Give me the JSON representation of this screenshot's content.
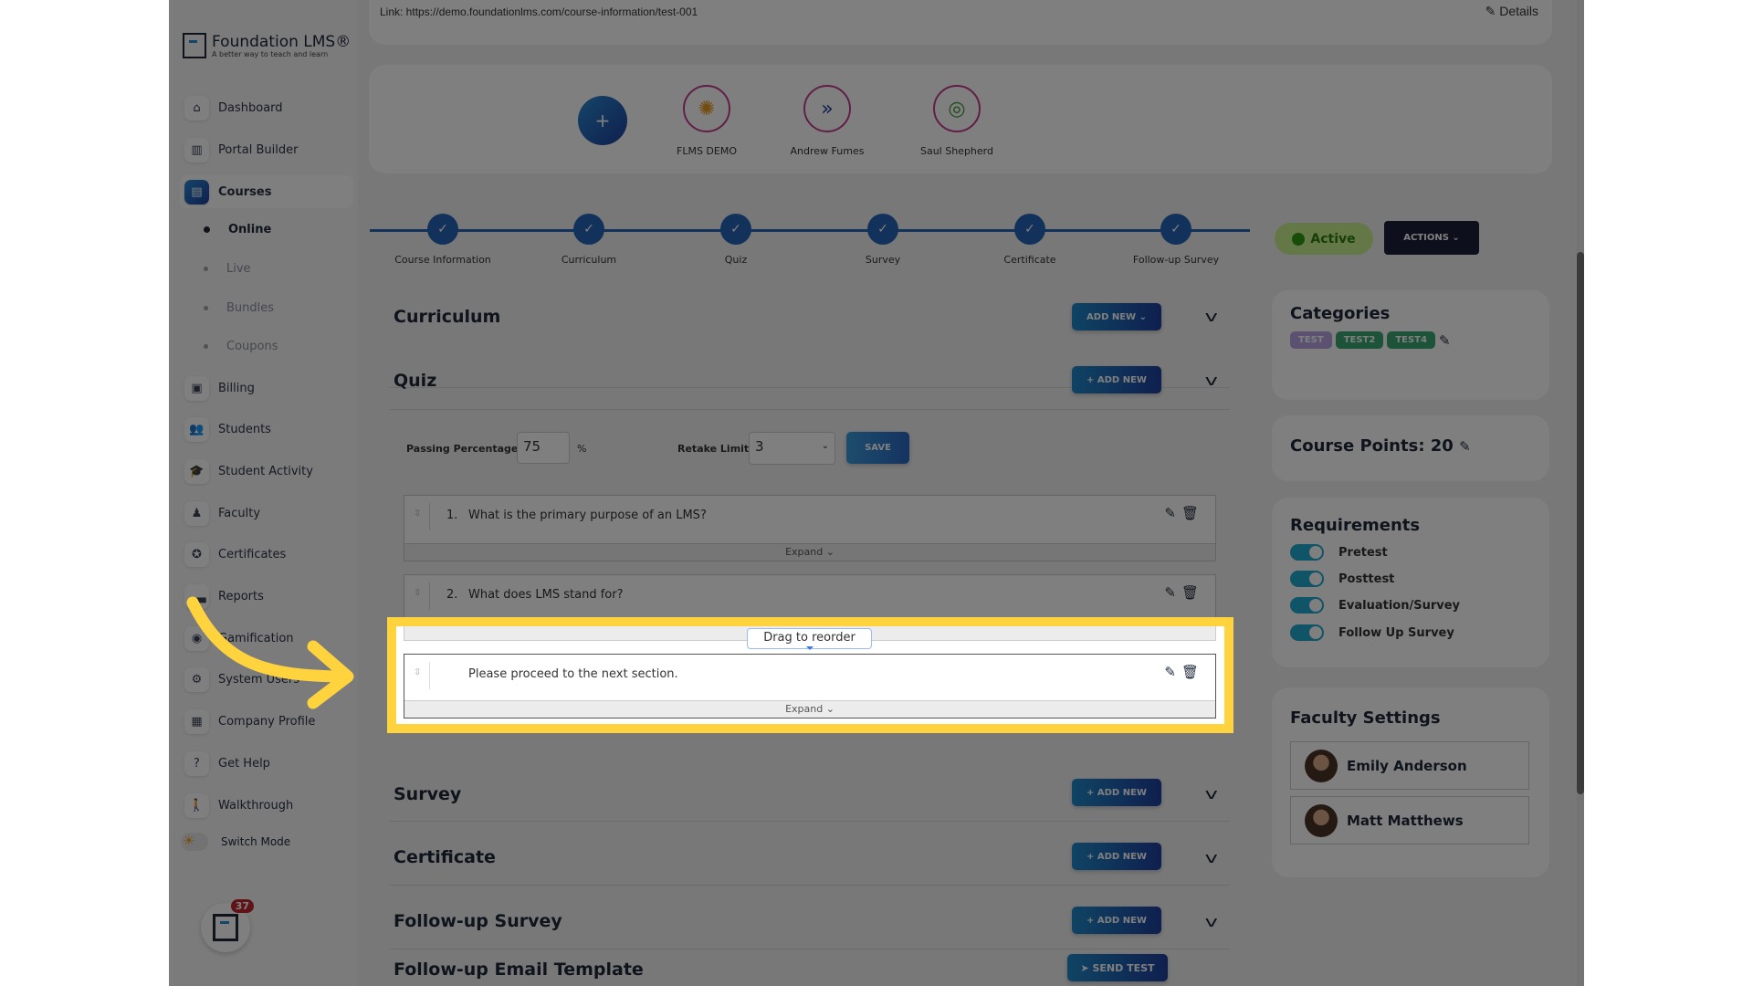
{
  "brand": {
    "name": "Foundation LMS®",
    "tagline": "A better way to teach and learn"
  },
  "sidebar": {
    "items": [
      {
        "label": "Dashboard",
        "icon": "home-icon"
      },
      {
        "label": "Portal Builder",
        "icon": "portal-icon"
      },
      {
        "label": "Courses",
        "icon": "book-icon",
        "active": true
      },
      {
        "label": "Billing",
        "icon": "receipt-icon"
      },
      {
        "label": "Students",
        "icon": "users-icon"
      },
      {
        "label": "Student Activity",
        "icon": "graduation-cap-icon"
      },
      {
        "label": "Faculty",
        "icon": "teacher-icon"
      },
      {
        "label": "Certificates",
        "icon": "award-icon"
      },
      {
        "label": "Reports",
        "icon": "chart-icon"
      },
      {
        "label": "Gamification",
        "icon": "gamepad-icon"
      },
      {
        "label": "System Users",
        "icon": "user-gear-icon"
      },
      {
        "label": "Company Profile",
        "icon": "building-icon"
      },
      {
        "label": "Get Help",
        "icon": "question-icon"
      },
      {
        "label": "Walkthrough",
        "icon": "walk-icon"
      }
    ],
    "sub_items": [
      {
        "label": "Online",
        "active": true
      },
      {
        "label": "Live"
      },
      {
        "label": "Bundles"
      },
      {
        "label": "Coupons"
      }
    ],
    "switch_mode": "Switch Mode",
    "notification_count": "37"
  },
  "header": {
    "link": "Link: https://demo.foundationlms.com/course-information/test-001",
    "details": "Details"
  },
  "instructors": [
    {
      "name": "FLMS DEMO"
    },
    {
      "name": "Andrew Fumes"
    },
    {
      "name": "Saul Shepherd"
    }
  ],
  "steps": [
    "Course Information",
    "Curriculum",
    "Quiz",
    "Survey",
    "Certificate",
    "Follow-up Survey"
  ],
  "sections": {
    "curriculum": {
      "title": "Curriculum",
      "button": "ADD NEW"
    },
    "quiz": {
      "title": "Quiz",
      "button": "+ ADD NEW",
      "passing_label": "Passing Percentage:",
      "passing_value": "75",
      "percent": "%",
      "retake_label": "Retake Limit:",
      "retake_value": "3",
      "save": "SAVE",
      "questions": [
        {
          "num": "1.",
          "text": "What is the primary purpose of an LMS?"
        },
        {
          "num": "2.",
          "text": "What does LMS stand for?"
        },
        {
          "num": "",
          "text": "Please proceed to the next section."
        }
      ],
      "expand": "Expand",
      "tooltip": "Drag to reorder"
    },
    "survey": {
      "title": "Survey",
      "button": "+ ADD NEW"
    },
    "certificate": {
      "title": "Certificate",
      "button": "+ ADD NEW"
    },
    "followup": {
      "title": "Follow-up Survey",
      "button": "+ ADD NEW"
    },
    "email": {
      "title": "Follow-up Email Template",
      "button": "SEND TEST"
    }
  },
  "status": {
    "label": "Active",
    "color": "#2f9a10"
  },
  "actions": "ACTIONS",
  "categories": {
    "title": "Categories",
    "tags": [
      {
        "label": "TEST",
        "color": "#b9a3e3"
      },
      {
        "label": "TEST2",
        "color": "#3aa772"
      },
      {
        "label": "TEST4",
        "color": "#3aa772"
      }
    ]
  },
  "course_points": "Course Points: 20",
  "requirements": {
    "title": "Requirements",
    "items": [
      {
        "label": "Pretest",
        "on": true
      },
      {
        "label": "Posttest",
        "on": true
      },
      {
        "label": "Evaluation/Survey",
        "on": true
      },
      {
        "label": "Follow Up Survey",
        "on": true
      }
    ]
  },
  "faculty": {
    "title": "Faculty Settings",
    "members": [
      {
        "name": "Emily Anderson"
      },
      {
        "name": "Matt Matthews"
      }
    ]
  },
  "colors": {
    "primary": "#1e3f9c",
    "accent": "#1e88c8",
    "highlight": "#ffd33d"
  }
}
